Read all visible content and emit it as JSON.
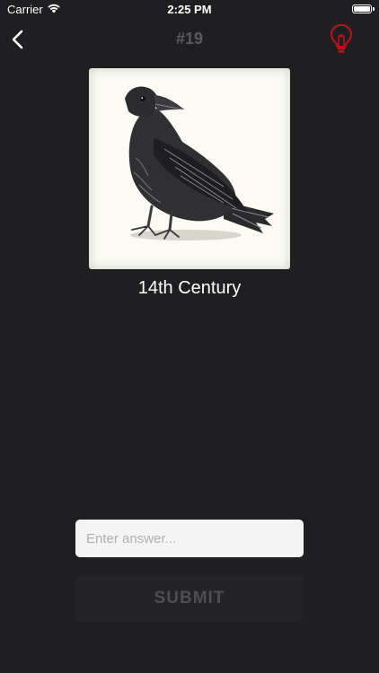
{
  "status_bar": {
    "carrier": "Carrier",
    "time": "2:25 PM",
    "wifi_icon": "wifi-icon",
    "battery_icon": "battery-icon"
  },
  "nav": {
    "back_icon": "chevron-left-icon",
    "title": "#19",
    "hint_icon": "lightbulb-icon",
    "hint_color": "#c0121b"
  },
  "puzzle": {
    "image_subject": "raven-illustration",
    "caption": "14th Century"
  },
  "answer": {
    "value": "",
    "placeholder": "Enter answer..."
  },
  "submit": {
    "label": "SUBMIT"
  },
  "colors": {
    "background": "#1f1f22",
    "title_gray": "#5a5a5e",
    "input_bg": "#f4f4f4",
    "button_bg": "#242427",
    "button_text": "#4e4e52"
  }
}
